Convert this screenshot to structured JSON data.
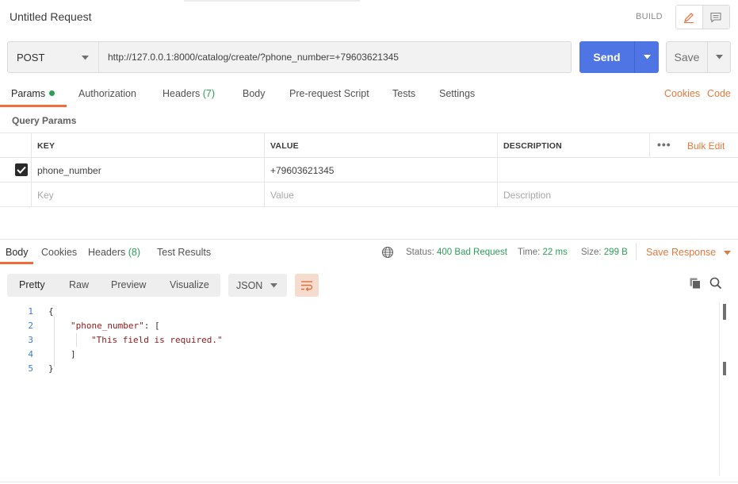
{
  "header": {
    "title": "Untitled Request",
    "build_label": "BUILD"
  },
  "request": {
    "method": "POST",
    "url": "http://127.0.0.1:8000/catalog/create/?phone_number=+79603621345",
    "send_label": "Send",
    "save_label": "Save"
  },
  "request_tabs": [
    {
      "label": "Params",
      "active": true
    },
    {
      "label": "Authorization"
    },
    {
      "label": "Headers",
      "count": "(7)"
    },
    {
      "label": "Body"
    },
    {
      "label": "Pre-request Script"
    },
    {
      "label": "Tests"
    },
    {
      "label": "Settings"
    }
  ],
  "links": {
    "cookies": "Cookies",
    "code": "Code"
  },
  "query_params": {
    "label": "Query Params",
    "headers": [
      "KEY",
      "VALUE",
      "DESCRIPTION"
    ],
    "bulk_edit": "Bulk Edit",
    "rows": [
      {
        "checked": true,
        "key": "phone_number",
        "value": "+79603621345",
        "description": ""
      }
    ],
    "placeholders": {
      "key": "Key",
      "value": "Value",
      "description": "Description"
    }
  },
  "response": {
    "tabs": [
      {
        "label": "Body",
        "active": true
      },
      {
        "label": "Cookies"
      },
      {
        "label": "Headers",
        "count": "(8)"
      },
      {
        "label": "Test Results"
      }
    ],
    "status_label": "Status:",
    "status_value": "400 Bad Request",
    "time_label": "Time:",
    "time_value": "22 ms",
    "size_label": "Size:",
    "size_value": "299 B",
    "save_response": "Save Response",
    "view_modes": [
      "Pretty",
      "Raw",
      "Preview",
      "Visualize"
    ],
    "format": "JSON",
    "code_lines": [
      {
        "num": "1",
        "text": "{"
      },
      {
        "num": "2",
        "key": "\"phone_number\"",
        "rest": ": ["
      },
      {
        "num": "3",
        "str": "\"This field is required.\""
      },
      {
        "num": "4",
        "text": "]"
      },
      {
        "num": "5",
        "text": "}"
      }
    ]
  },
  "colors": {
    "accent": "#f26b3a",
    "send": "#4f74e3",
    "success": "#2b9e57",
    "link": "#e07a3f"
  }
}
